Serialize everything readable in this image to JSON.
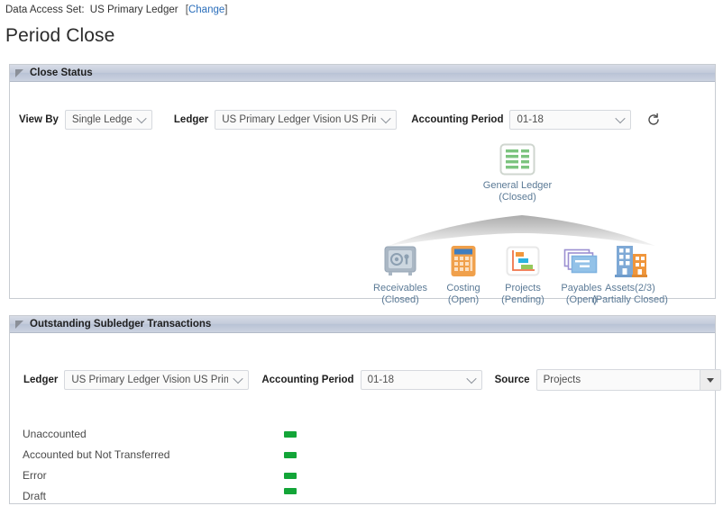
{
  "topbar": {
    "data_access_label": "Data Access Set:",
    "data_access_value": "US Primary Ledger",
    "change_open": "[",
    "change_link": "Change",
    "change_close": "]"
  },
  "page": {
    "title": "Period Close"
  },
  "close_status": {
    "panel_title": "Close Status",
    "view_by_label": "View By",
    "view_by_value": "Single Ledger",
    "ledger_label": "Ledger",
    "ledger_value": "US Primary Ledger Vision US Primary Le",
    "period_label": "Accounting Period",
    "period_value": "01-18",
    "refresh_name": "refresh-icon",
    "parent_node": {
      "icon": "general-ledger-grid-icon",
      "label": "General Ledger",
      "status": "(Closed)"
    },
    "child_nodes": [
      {
        "icon": "safe-vault-icon",
        "label": "Receivables",
        "status": "(Closed)"
      },
      {
        "icon": "calculator-icon",
        "label": "Costing",
        "status": "(Open)"
      },
      {
        "icon": "gantt-chart-icon",
        "label": "Projects",
        "status": "(Pending)"
      },
      {
        "icon": "stacked-cards-icon",
        "label": "Payables",
        "status": "(Open)"
      },
      {
        "icon": "buildings-icon",
        "label": "Assets(2/3)",
        "status": "(Partially Closed)"
      }
    ]
  },
  "outstanding": {
    "panel_title": "Outstanding Subledger Transactions",
    "ledger_label": "Ledger",
    "ledger_value": "US Primary Ledger Vision US Primary Le",
    "period_label": "Accounting Period",
    "period_value": "01-18",
    "source_label": "Source",
    "source_value": "Projects",
    "refresh_name": "refresh-icon",
    "rows": [
      {
        "label": "Unaccounted"
      },
      {
        "label": "Accounted but Not Transferred"
      },
      {
        "label": "Error"
      },
      {
        "label": "Draft"
      }
    ]
  },
  "colors": {
    "bar_green": "#13a538",
    "link_blue": "#2a6ebb",
    "node_label": "#5b7a96"
  }
}
